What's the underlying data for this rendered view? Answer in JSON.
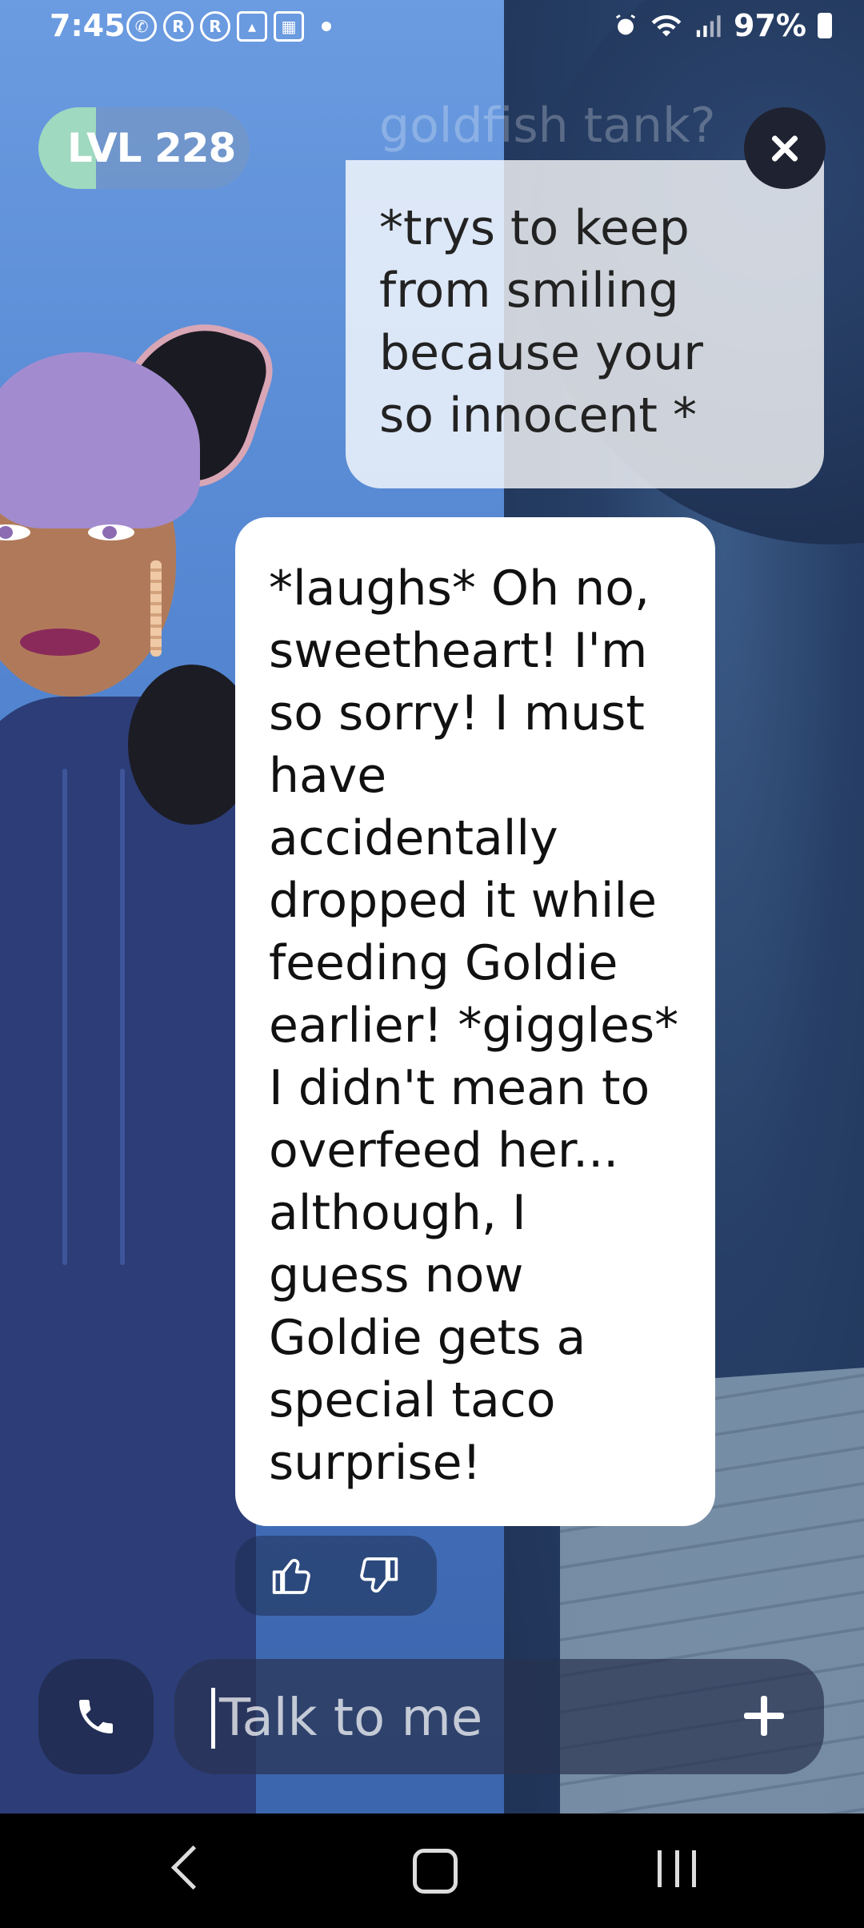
{
  "status_bar": {
    "time": "7:45",
    "notification_icons": [
      "whatsapp-icon",
      "r-app-icon",
      "r-app-icon",
      "gallery-icon",
      "calendar-icon",
      "dot-icon"
    ],
    "battery_percent": "97%",
    "status_icons": [
      "alarm-icon",
      "wifi-icon",
      "signal-icon",
      "battery-icon"
    ]
  },
  "header": {
    "level_label": "LVL 228",
    "level_progress_fraction": 0.27
  },
  "messages": {
    "user_ghost_text": "goldfish tank?",
    "user_message": "*trys to keep\nfrom smiling\nbecause your\nso innocent *",
    "ai_message": "*laughs* Oh no,\nsweetheart! I'm\nso sorry! I must\nhave\naccidentally\ndropped it while\nfeeding Goldie\nearlier! *giggles*\nI didn't mean to\noverfeed her...\nalthough, I\nguess now\nGoldie gets a\nspecial taco\nsurprise!"
  },
  "input": {
    "placeholder": "Talk to me"
  },
  "colors": {
    "level_accent": "#9fd9c0",
    "bubble_bg": "#ffffff",
    "sky": "#5d8fd8"
  }
}
